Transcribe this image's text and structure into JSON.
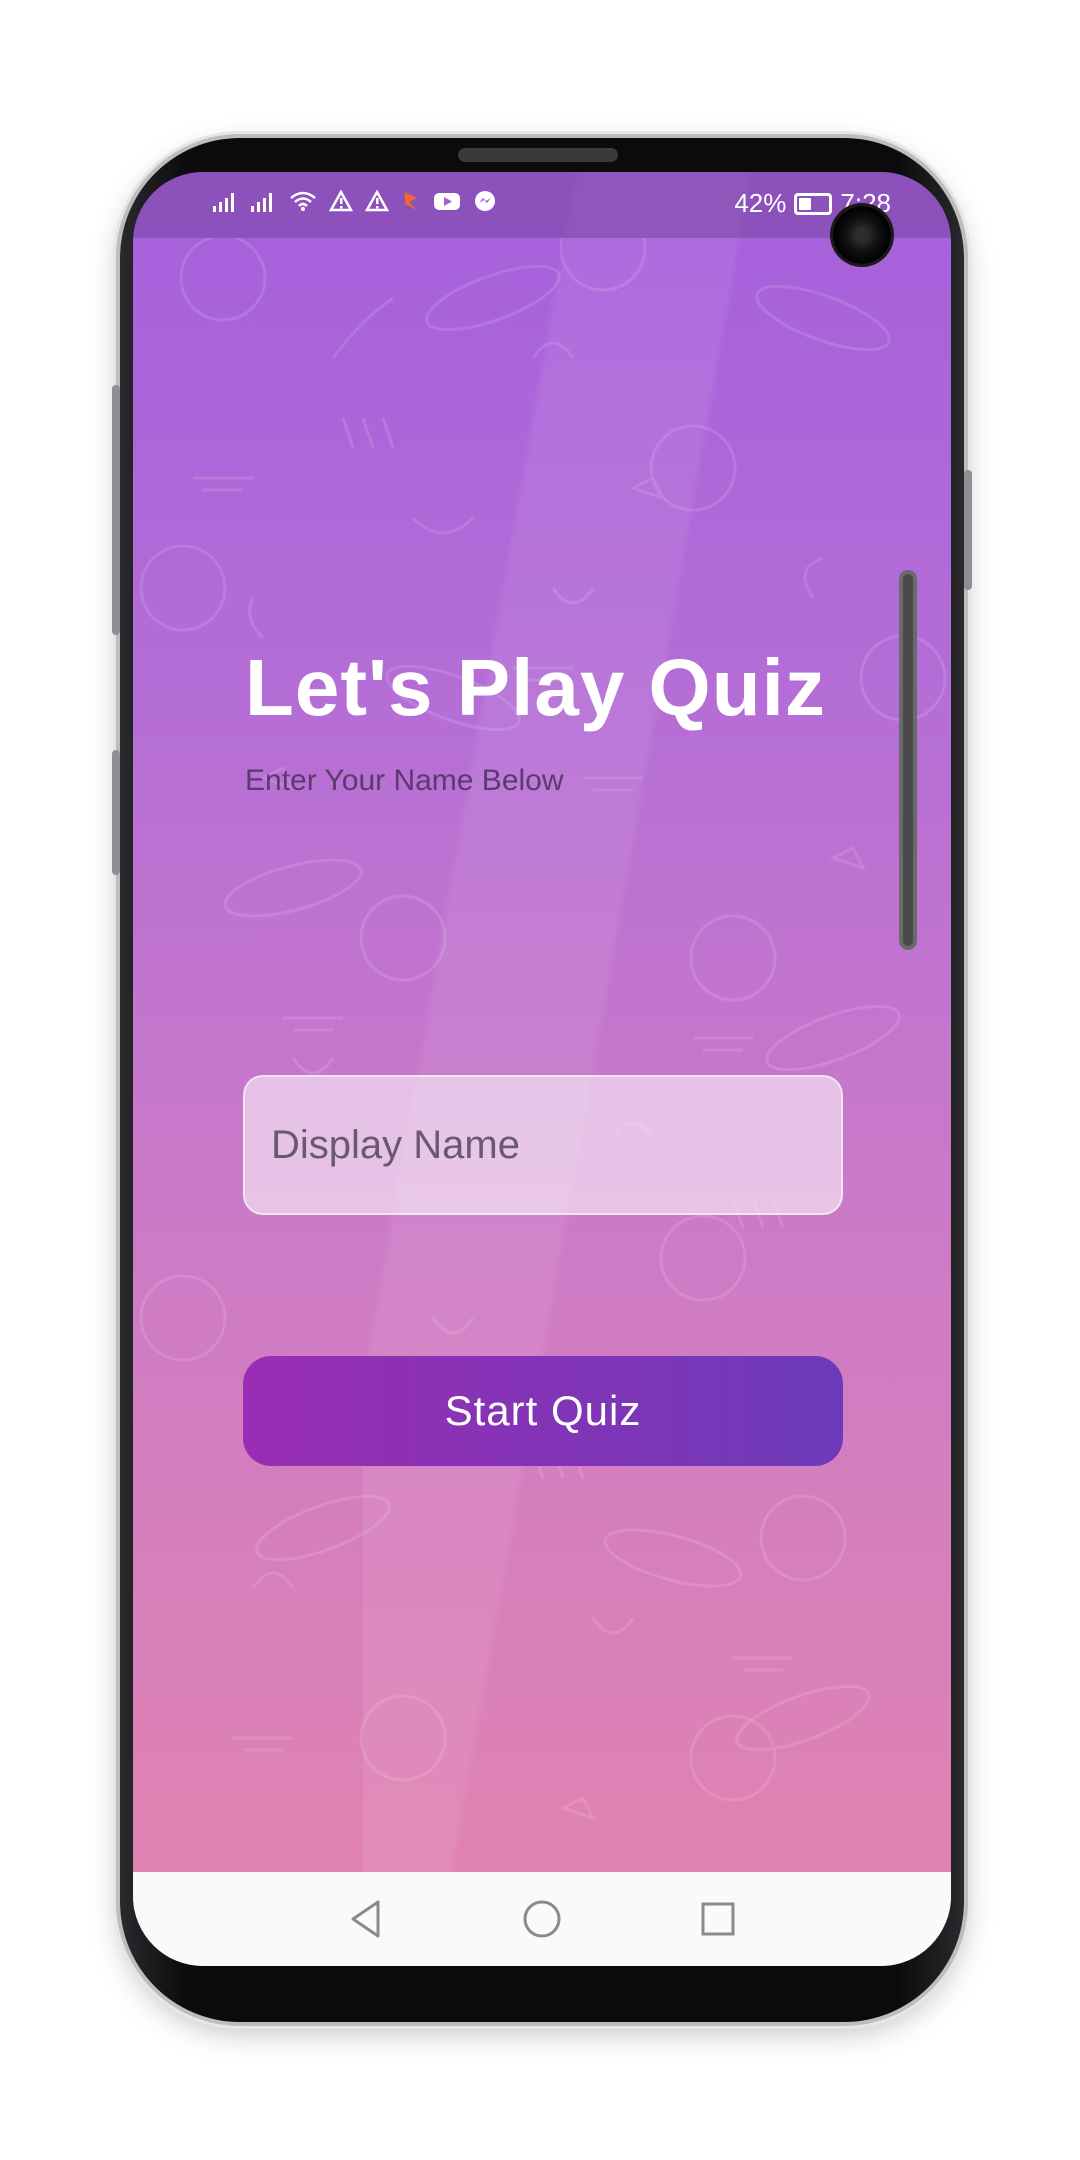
{
  "status_bar": {
    "battery": "42%",
    "battery_level": 0.42,
    "time": "7:28",
    "icons": [
      "signal-icon",
      "signal-icon",
      "wifi-icon",
      "warning-icon",
      "warning-icon",
      "notification-icon",
      "youtube-icon",
      "messenger-icon"
    ]
  },
  "main": {
    "title": "Let's Play Quiz",
    "subtitle": "Enter Your Name Below",
    "name_placeholder": "Display Name",
    "start_label": "Start Quiz"
  },
  "navigation": {
    "back_icon": "back-triangle-icon",
    "home_icon": "home-circle-icon",
    "recents_icon": "recents-square-icon"
  },
  "colors": {
    "gradient_top": "#a55fdc",
    "gradient_bottom": "#e384af",
    "button_start": "#9a2db3",
    "button_end": "#6c3ab9",
    "title_text": "#ffffff",
    "subtitle_text": "#5b3a6e"
  }
}
